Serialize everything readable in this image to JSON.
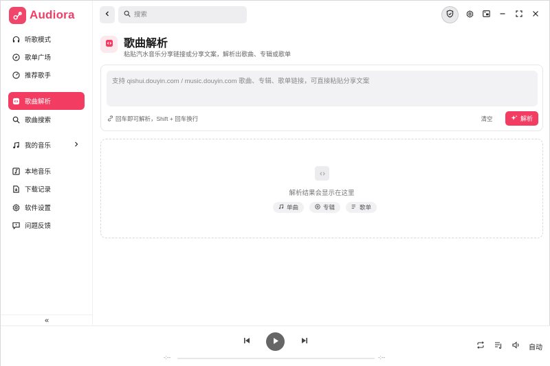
{
  "app": {
    "name": "Audiora",
    "accent": "#f23c61"
  },
  "sidebar": {
    "items": [
      {
        "label": "听歌模式",
        "icon": "headphones-icon"
      },
      {
        "label": "歌单广场",
        "icon": "compass-icon"
      },
      {
        "label": "推荐歌手",
        "icon": "disc-icon"
      },
      {
        "label": "歌曲解析",
        "icon": "parse-icon",
        "active": true
      },
      {
        "label": "歌曲搜索",
        "icon": "search-icon"
      },
      {
        "label": "我的音乐",
        "icon": "music-note-icon",
        "expandable": true
      },
      {
        "label": "本地音乐",
        "icon": "local-music-icon"
      },
      {
        "label": "下载记录",
        "icon": "download-icon"
      },
      {
        "label": "软件设置",
        "icon": "gear-icon"
      },
      {
        "label": "问题反馈",
        "icon": "feedback-icon"
      }
    ],
    "collapse_label": "«"
  },
  "topbar": {
    "search_placeholder": "搜索"
  },
  "page": {
    "title": "歌曲解析",
    "subtitle": "粘贴汽水音乐分享链接或分享文案，解析出歌曲、专辑或歌单"
  },
  "input": {
    "placeholder": "支持 qishui.douyin.com / music.douyin.com 歌曲、专辑、歌单链接，可直接粘贴分享文案",
    "hint": "回车即可解析，Shift + 回车换行",
    "clear_label": "清空",
    "parse_label": "解析"
  },
  "result": {
    "empty_text": "解析结果会显示在这里",
    "chips": [
      {
        "label": "单曲",
        "icon": "music-note-icon"
      },
      {
        "label": "专辑",
        "icon": "disc-icon"
      },
      {
        "label": "歌单",
        "icon": "playlist-icon"
      }
    ]
  },
  "player": {
    "time_current": "-:--",
    "time_total": "-:--",
    "mode_label": "自动"
  }
}
